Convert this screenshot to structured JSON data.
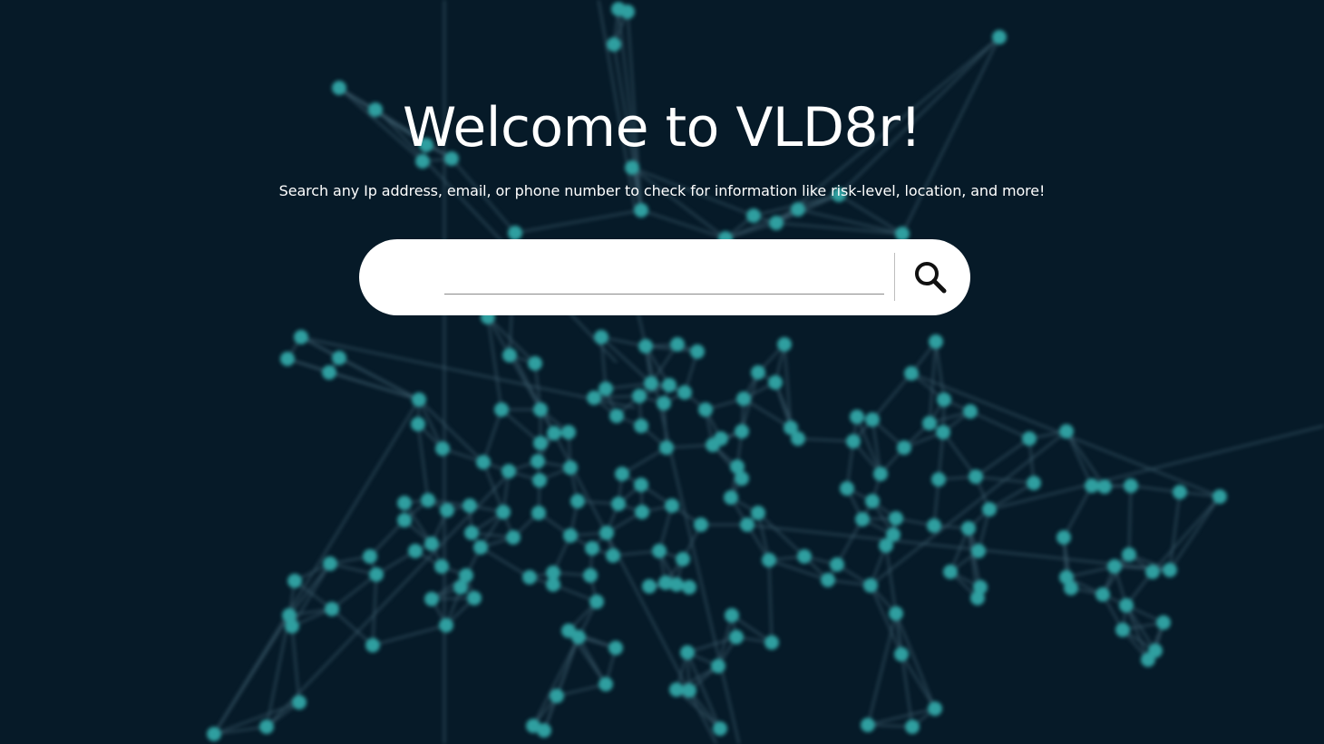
{
  "hero": {
    "title": "Welcome to VLD8r!",
    "subtitle": "Search any Ip address, email, or phone number to check for information like risk-level, location, and more!"
  },
  "search": {
    "value": "",
    "placeholder": "",
    "icon": "search-icon"
  },
  "colors": {
    "background": "#061a28",
    "node": "#2f9fa0",
    "edge": "#3a5a6a",
    "text": "#ffffff",
    "search_box": "#ffffff"
  }
}
